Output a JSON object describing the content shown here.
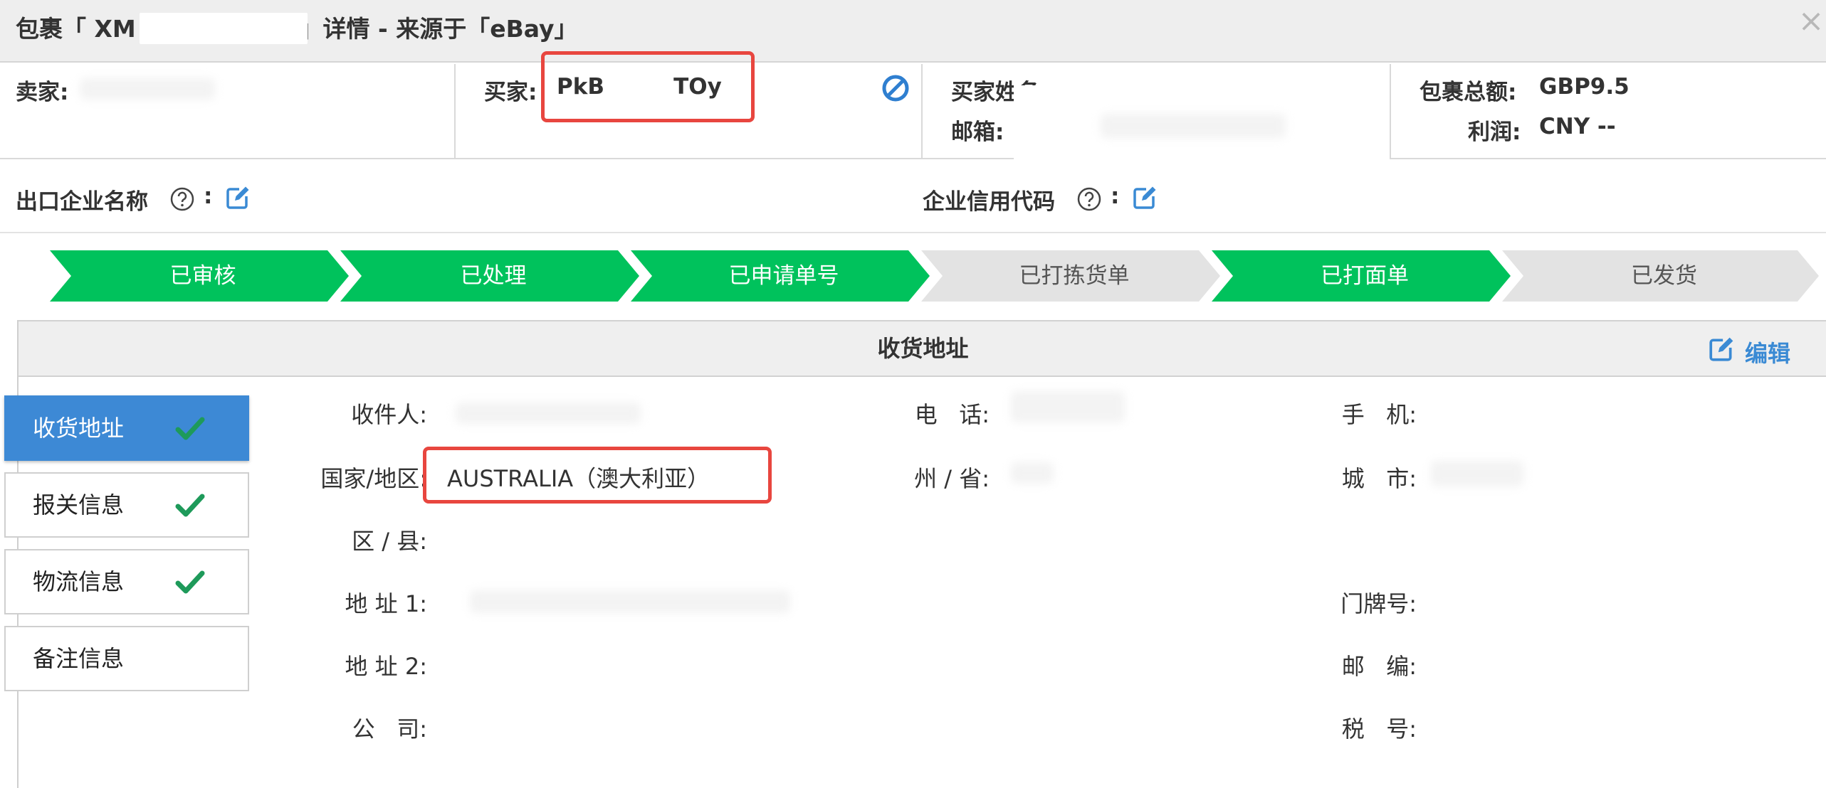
{
  "window": {
    "title": "包裹「 XM                    」详情 - 来源于「eBay」",
    "close_glyph": "×"
  },
  "info": {
    "seller_label": "卖家:",
    "buyer_label": "买家:",
    "buyer_value": "PkB         TOy",
    "buyer_name_label": "买家姓名:",
    "email_label": "邮箱:",
    "total_label": "包裹总额:",
    "total_value": "GBP9.5",
    "profit_label": "利润:",
    "profit_value": "CNY --"
  },
  "company": {
    "export_name_label": "出口企业名称",
    "credit_code_label": "企业信用代码",
    "colon": ":"
  },
  "steps": [
    {
      "label": "已审核",
      "done": true
    },
    {
      "label": "已处理",
      "done": true
    },
    {
      "label": "已申请单号",
      "done": true
    },
    {
      "label": "已打拣货单",
      "done": false
    },
    {
      "label": "已打面单",
      "done": true
    },
    {
      "label": "已发货",
      "done": false
    }
  ],
  "panel": {
    "title": "收货地址",
    "edit_label": "编辑"
  },
  "side_nav": [
    {
      "label": "收货地址",
      "checked": true,
      "active": true
    },
    {
      "label": "报关信息",
      "checked": true,
      "active": false
    },
    {
      "label": "物流信息",
      "checked": true,
      "active": false
    },
    {
      "label": "备注信息",
      "checked": false,
      "active": false
    }
  ],
  "form": {
    "recipient_label": "收件人:",
    "phone_label": "电   话:",
    "mobile_label": "手   机:",
    "country_label": "国家/地区:",
    "country_value": "AUSTRALIA（澳大利亚）",
    "state_label": "州 / 省:",
    "city_label": "城   市:",
    "district_label": "区 / 县:",
    "address1_label": "地 址 1:",
    "house_number_label": "门牌号:",
    "address2_label": "地 址 2:",
    "postcode_label": "邮   编:",
    "company_label": "公   司:",
    "tax_label": "税   号:"
  },
  "colors": {
    "step_done": "#00c25c",
    "step_todo": "#e3e3e3",
    "accent_blue": "#3d89d5",
    "highlight_red": "#e8463f",
    "check_green": "#1e9a5a"
  }
}
